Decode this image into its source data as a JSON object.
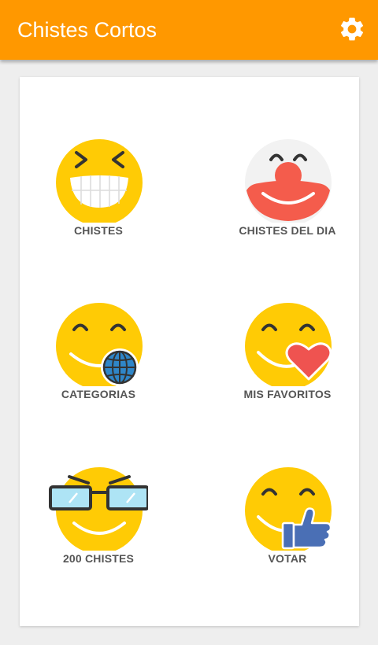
{
  "header": {
    "title": "Chistes Cortos",
    "settings_icon": "gear-icon",
    "background": "#ff9800"
  },
  "menu": {
    "items": [
      {
        "label": "CHISTES",
        "icon": "grinning-face-icon"
      },
      {
        "label": "CHISTES DEL DIA",
        "icon": "clown-face-icon"
      },
      {
        "label": "CATEGORIAS",
        "icon": "smiley-globe-icon"
      },
      {
        "label": "MIS FAVORITOS",
        "icon": "smiley-heart-icon"
      },
      {
        "label": "200 CHISTES",
        "icon": "smiley-sunglasses-icon"
      },
      {
        "label": "VOTAR",
        "icon": "smiley-thumbs-up-icon"
      }
    ]
  },
  "colors": {
    "emoji_yellow": "#ffcb05",
    "clown_red": "#f45c4c",
    "heart_red": "#ef5350",
    "globe_blue": "#2f86c8",
    "thumb_blue": "#4a6fb5",
    "label_gray": "#555555"
  }
}
